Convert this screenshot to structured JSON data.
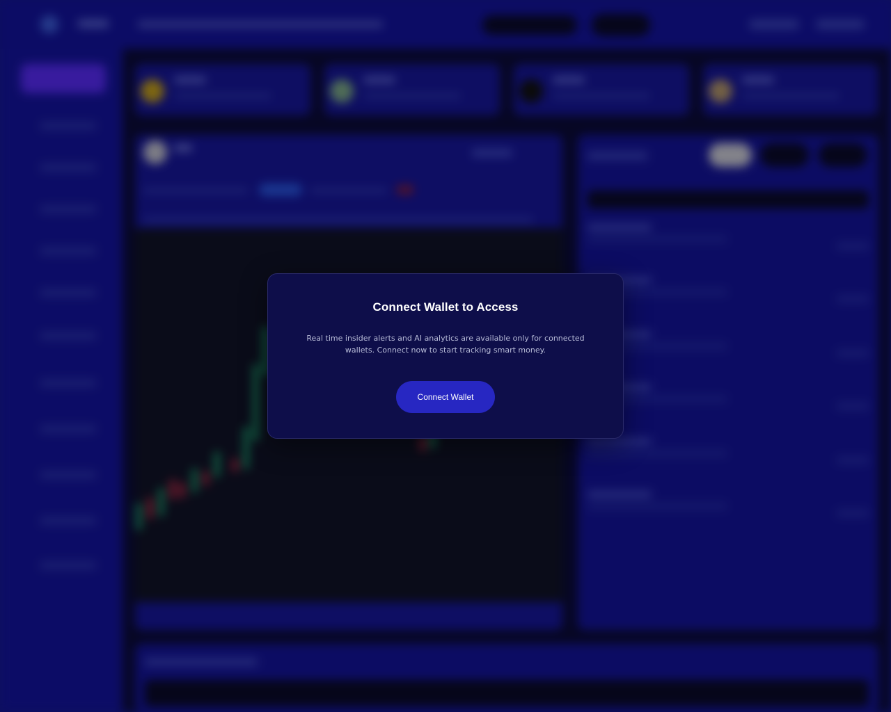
{
  "modal": {
    "title": "Connect Wallet to Access",
    "description": "Real time insider alerts and AI analytics are available only for connected wallets. Connect now to start tracking smart money.",
    "button_label": "Connect Wallet"
  },
  "colors": {
    "accent": "#2727c2",
    "modal_bg": "#0e0e4a",
    "app_bg": "#14149a",
    "positive": "#1fb07a",
    "negative": "#d0304f"
  }
}
